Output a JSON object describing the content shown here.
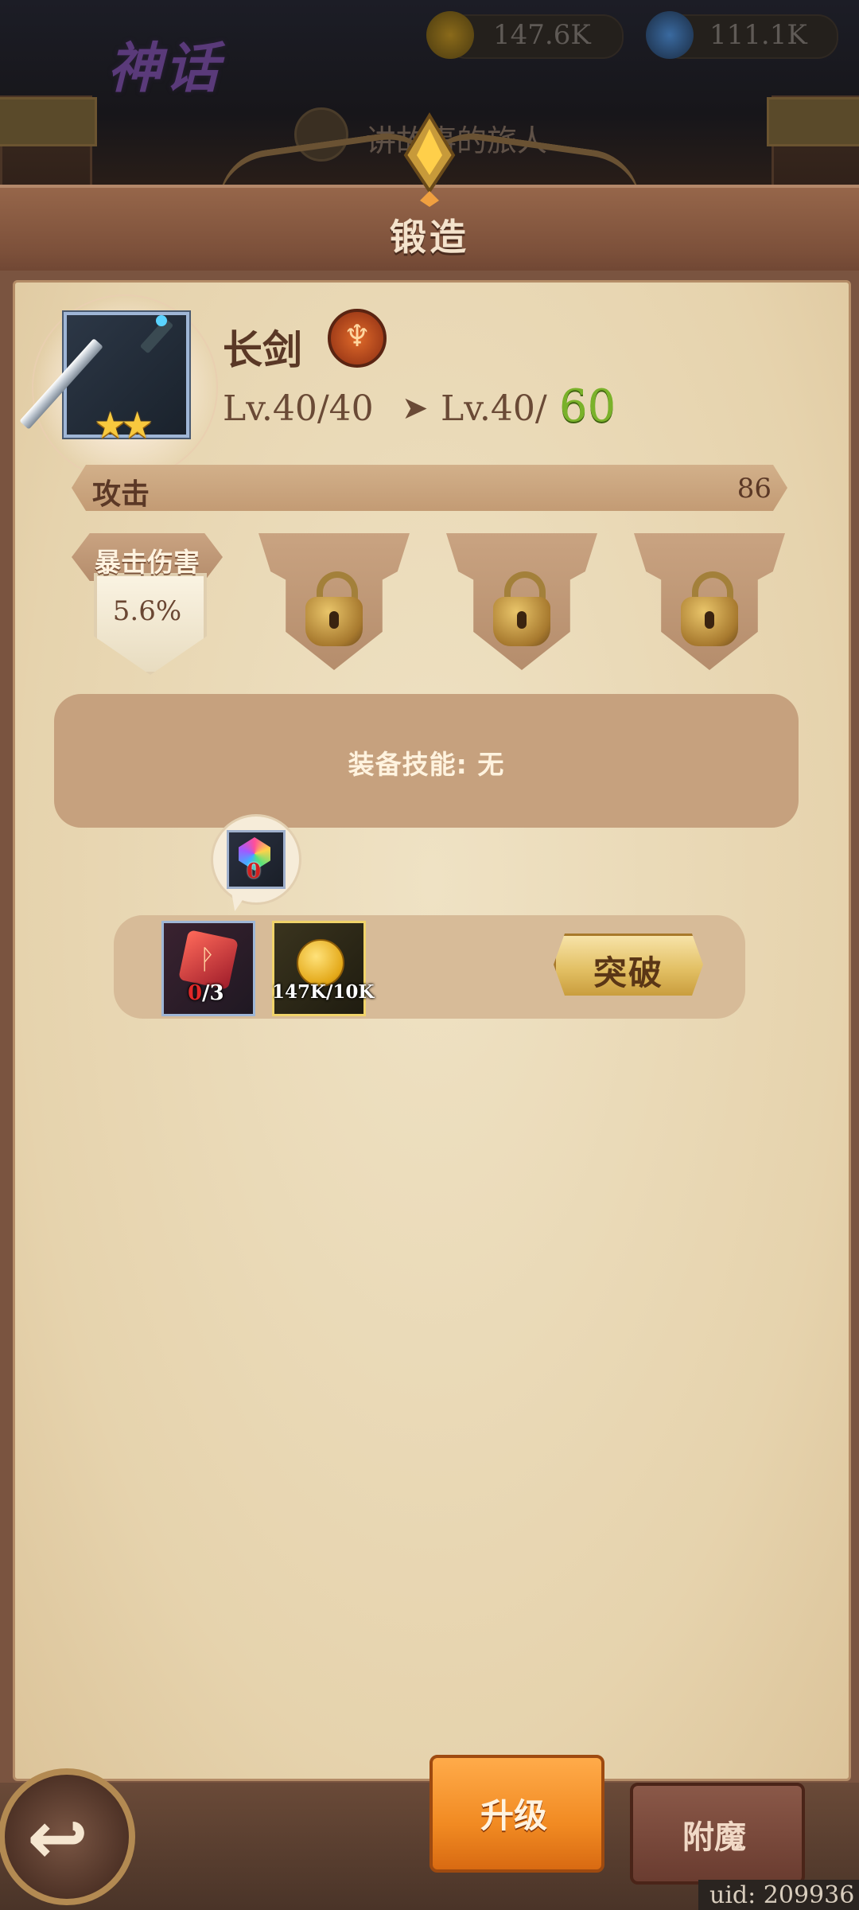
{
  "header": {
    "game_title": "神话",
    "resource_gold": "147.6K",
    "resource_gem": "111.1K",
    "subtitle": "讲故事的旅人"
  },
  "forge": {
    "title": "锻造"
  },
  "item": {
    "name": "长剑",
    "stars": 2,
    "level_current": "Lv.40/40",
    "level_next_prefix": "Lv.40/",
    "level_next_max": "60"
  },
  "stat": {
    "label": "攻击",
    "value": "86"
  },
  "slots": {
    "active_title": "暴击伤害",
    "active_value": "5.6%",
    "locked_count": 3
  },
  "skill": {
    "text": "装备技能: 无"
  },
  "materials": {
    "bubble_count": "0",
    "red_material_have": "0",
    "red_material_need": "/3",
    "gold_amount": "147K/10K",
    "breakthrough_label": "突破"
  },
  "bottom": {
    "upgrade_label": "升级",
    "enchant_label": "附魔",
    "uid": "uid: 209936"
  },
  "colors": {
    "accent_orange": "#f18a22",
    "level_green": "#7ab22a",
    "material_red_count": "#d02020"
  }
}
